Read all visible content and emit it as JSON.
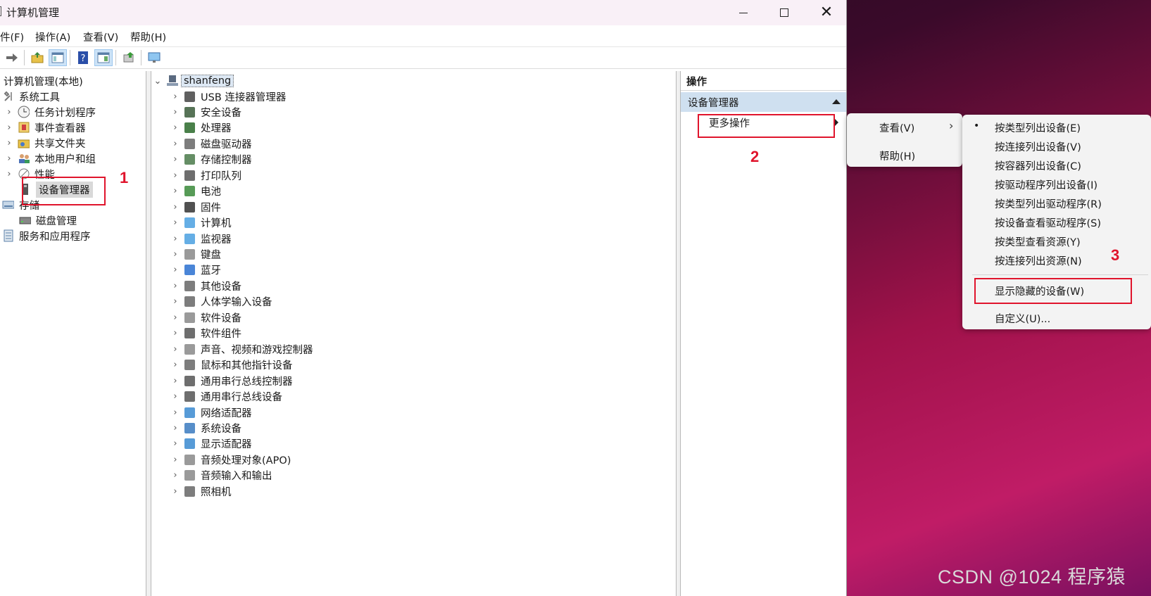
{
  "window": {
    "title": "计算机管理",
    "minimize_symbol": "",
    "maximize_symbol": "",
    "close_symbol": "✕"
  },
  "menubar": [
    "件(F)",
    "操作(A)",
    "查看(V)",
    "帮助(H)"
  ],
  "left_tree": {
    "root": "计算机管理(本地)",
    "system_tools": "系统工具",
    "items": [
      "任务计划程序",
      "事件查看器",
      "共享文件夹",
      "本地用户和组",
      "性能",
      "设备管理器"
    ],
    "storage": "存储",
    "disk_mgmt": "磁盘管理",
    "services": "服务和应用程序"
  },
  "device_tree": {
    "root": "shanfeng",
    "items": [
      "USB 连接器管理器",
      "安全设备",
      "处理器",
      "磁盘驱动器",
      "存储控制器",
      "打印队列",
      "电池",
      "固件",
      "计算机",
      "监视器",
      "键盘",
      "蓝牙",
      "其他设备",
      "人体学输入设备",
      "软件设备",
      "软件组件",
      "声音、视频和游戏控制器",
      "鼠标和其他指针设备",
      "通用串行总线控制器",
      "通用串行总线设备",
      "网络适配器",
      "系统设备",
      "显示适配器",
      "音频处理对象(APO)",
      "音频输入和输出",
      "照相机"
    ]
  },
  "actions": {
    "header": "操作",
    "section": "设备管理器",
    "more": "更多操作"
  },
  "context_menu_1": [
    "查看(V)",
    "帮助(H)"
  ],
  "context_menu_2": {
    "items": [
      "按类型列出设备(E)",
      "按连接列出设备(V)",
      "按容器列出设备(C)",
      "按驱动程序列出设备(I)",
      "按类型列出驱动程序(R)",
      "按设备查看驱动程序(S)",
      "按类型查看资源(Y)",
      "按连接列出资源(N)"
    ],
    "show_hidden": "显示隐藏的设备(W)",
    "customize": "自定义(U)..."
  },
  "annotations": [
    "1",
    "2",
    "3"
  ],
  "watermark": "CSDN @1024 程序猿",
  "colors": {
    "highlight": "#e0142c",
    "selection": "#d9d9d9",
    "action_band": "#cfe0f0"
  }
}
